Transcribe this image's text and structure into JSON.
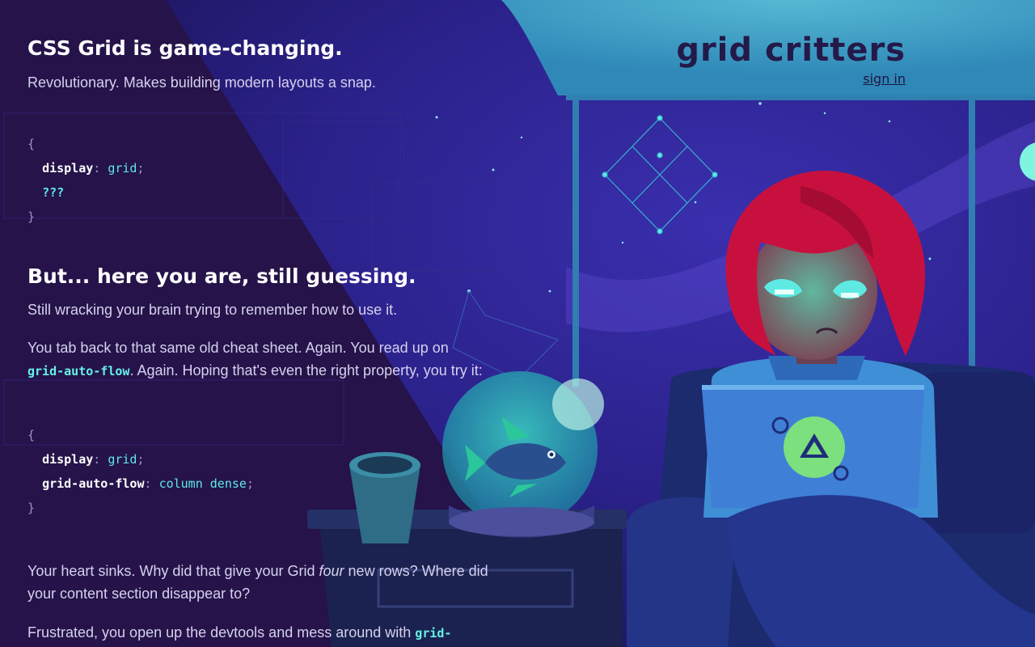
{
  "header": {
    "logo": "grid critters",
    "sign_in": "sign in"
  },
  "section1": {
    "heading": "CSS Grid is game-changing.",
    "subtitle": "Revolutionary. Makes building modern layouts a snap."
  },
  "code1": {
    "open": "{",
    "prop": "display",
    "colon": ":",
    "val": "grid",
    "semi": ";",
    "mystery": "???",
    "close": "}"
  },
  "section2": {
    "heading": "But... here you are, still guessing.",
    "p1": "Still wracking your brain trying to remember how to use it.",
    "p2_before": "You tab back to that same old cheat sheet. Again. You read up on",
    "p2_code": "grid-auto-flow",
    "p2_after": ". Again. Hoping that's even the right property, you try it:"
  },
  "code2": {
    "open": "{",
    "prop1": "display",
    "val1": "grid",
    "prop2": "grid-auto-flow",
    "val2": "column dense",
    "colon": ":",
    "semi": ";",
    "close": "}"
  },
  "section3": {
    "p3_before": "Your heart sinks. Why did that give your Grid ",
    "p3_em": "four",
    "p3_after": " new rows? Where did your content section disappear to?",
    "p4_before": "Frustrated, you open up the devtools and mess around with ",
    "p4_code": "grid-"
  },
  "colors": {
    "page_bg": "#1f1352",
    "left_panel": "#25134a",
    "sky": "#2b2a8f",
    "window_frame": "#2f7fb0",
    "header_band": "#3a9bc4",
    "accent_cyan": "#5ee9e3",
    "hair": "#c8103f",
    "laptop": "#3f7fd6"
  },
  "icons": {
    "constellation": "constellation-icon",
    "fishbowl": "fishbowl-icon",
    "fish": "fish-icon",
    "cup": "cup-icon",
    "character": "character-illustration",
    "laptop_logo": "triangle-logo-icon",
    "moon": "moon-icon"
  }
}
